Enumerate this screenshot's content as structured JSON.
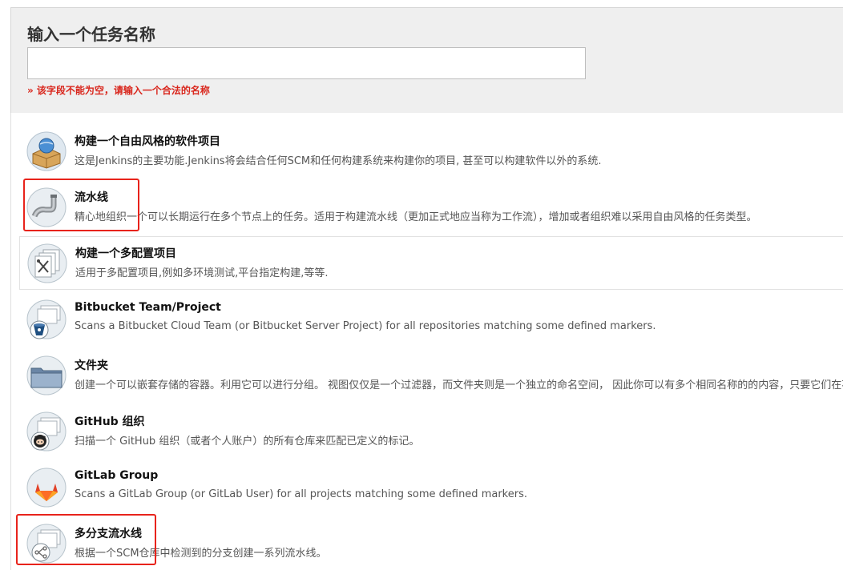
{
  "header": {
    "title": "输入一个任务名称",
    "input_value": "",
    "input_placeholder": "",
    "error": "» 该字段不能为空，请输入一个合法的名称"
  },
  "items": [
    {
      "title": "构建一个自由风格的软件项目",
      "desc": "这是Jenkins的主要功能.Jenkins将会结合任何SCM和任何构建系统来构建你的项目, 甚至可以构建软件以外的系统.",
      "icon": "freestyle-project-icon"
    },
    {
      "title": "流水线",
      "desc": "精心地组织一个可以长期运行在多个节点上的任务。适用于构建流水线（更加正式地应当称为工作流），增加或者组织难以采用自由风格的任务类型。",
      "icon": "pipeline-icon"
    },
    {
      "title": "构建一个多配置项目",
      "desc": "适用于多配置项目,例如多环境测试,平台指定构建,等等.",
      "icon": "multi-config-project-icon"
    },
    {
      "title": "Bitbucket Team/Project",
      "desc": "Scans a Bitbucket Cloud Team (or Bitbucket Server Project) for all repositories matching some defined markers.",
      "icon": "bitbucket-icon"
    },
    {
      "title": "文件夹",
      "desc": "创建一个可以嵌套存储的容器。利用它可以进行分组。 视图仅仅是一个过滤器，而文件夹则是一个独立的命名空间， 因此你可以有多个相同名称的的内容，只要它们在不同",
      "icon": "folder-icon"
    },
    {
      "title": "GitHub 组织",
      "desc": "扫描一个 GitHub 组织（或者个人账户）的所有仓库来匹配已定义的标记。",
      "icon": "github-icon"
    },
    {
      "title": "GitLab Group",
      "desc": "Scans a GitLab Group (or GitLab User) for all projects matching some defined markers.",
      "icon": "gitlab-icon"
    },
    {
      "title": "多分支流水线",
      "desc": "根据一个SCM仓库中检测到的分支创建一系列流水线。",
      "icon": "multibranch-pipeline-icon"
    }
  ],
  "colors": {
    "error_red": "#d9261c",
    "highlight_red": "#e8231b",
    "header_bg": "#efefef"
  }
}
